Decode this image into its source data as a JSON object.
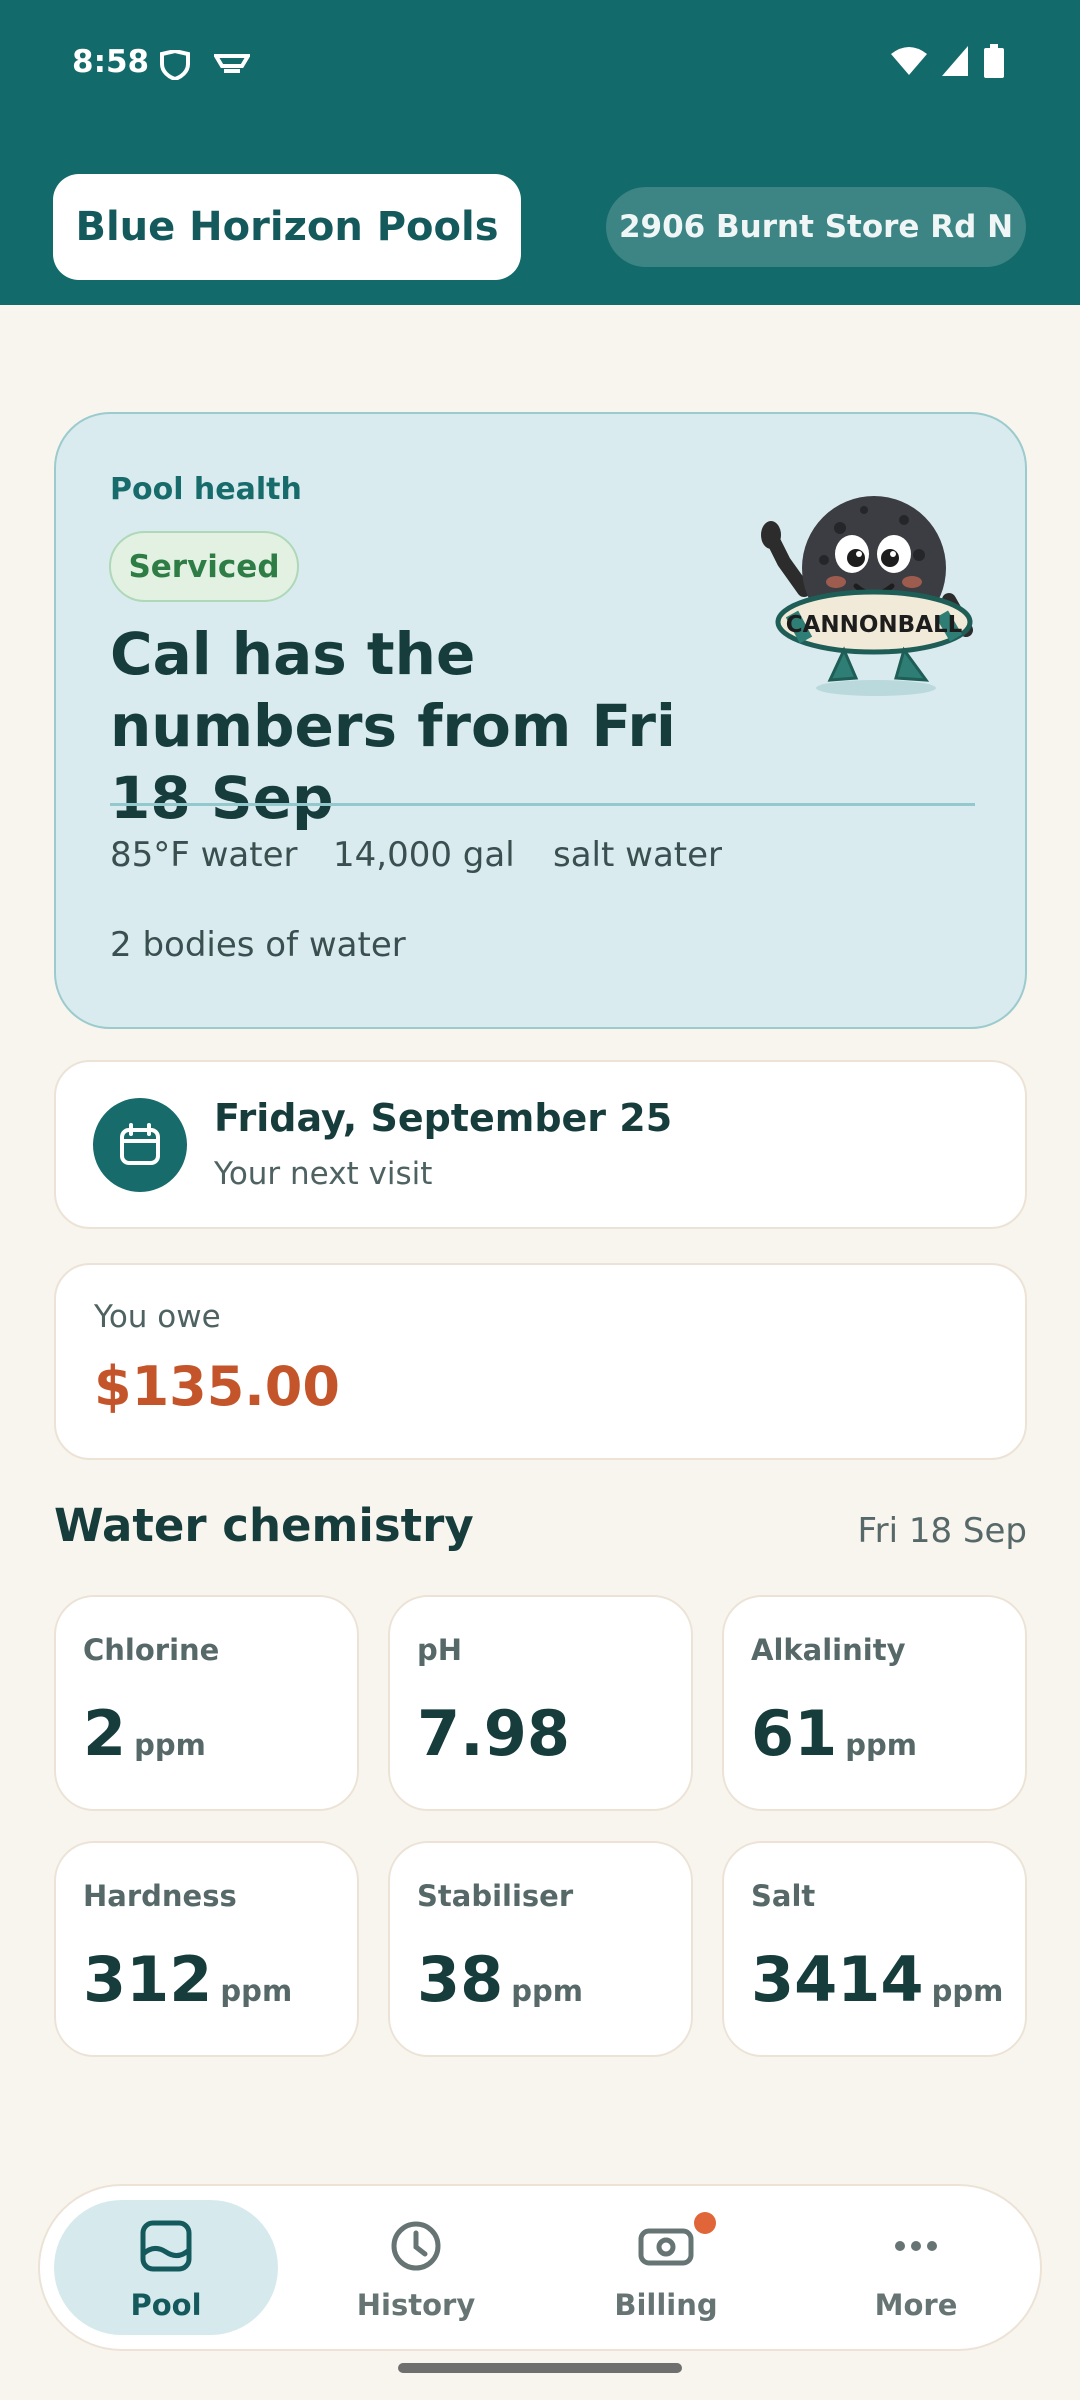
{
  "status_bar": {
    "time": "8:58"
  },
  "header": {
    "brand": "Blue Horizon Pools",
    "address": "2906 Burnt Store Rd N"
  },
  "health": {
    "label": "Pool health",
    "badge": "Serviced",
    "headline": "Cal has the numbers from Fri 18 Sep",
    "stats": [
      "85°F water",
      "14,000 gal",
      "salt water",
      "2 bodies of water"
    ],
    "mascot_text": "CANNONBALL"
  },
  "visit": {
    "date": "Friday, September 25",
    "subtitle": "Your next visit"
  },
  "balance": {
    "label": "You owe",
    "amount": "$135.00"
  },
  "chemistry": {
    "title": "Water chemistry",
    "date": "Fri 18 Sep",
    "metrics": [
      {
        "label": "Chlorine",
        "value": "2",
        "unit": "ppm"
      },
      {
        "label": "pH",
        "value": "7.98",
        "unit": ""
      },
      {
        "label": "Alkalinity",
        "value": "61",
        "unit": "ppm"
      },
      {
        "label": "Hardness",
        "value": "312",
        "unit": "ppm"
      },
      {
        "label": "Stabiliser",
        "value": "38",
        "unit": "ppm"
      },
      {
        "label": "Salt",
        "value": "3414",
        "unit": "ppm"
      }
    ]
  },
  "nav": {
    "items": [
      {
        "label": "Pool",
        "icon": "pool-icon"
      },
      {
        "label": "History",
        "icon": "clock-icon"
      },
      {
        "label": "Billing",
        "icon": "cash-icon"
      },
      {
        "label": "More",
        "icon": "more-dots-icon"
      }
    ]
  },
  "colors": {
    "header": "#136a6b",
    "accent": "#176b6b",
    "amount": "#c4552a",
    "background": "#f8f5ef",
    "notification_dot": "#e0663a"
  }
}
